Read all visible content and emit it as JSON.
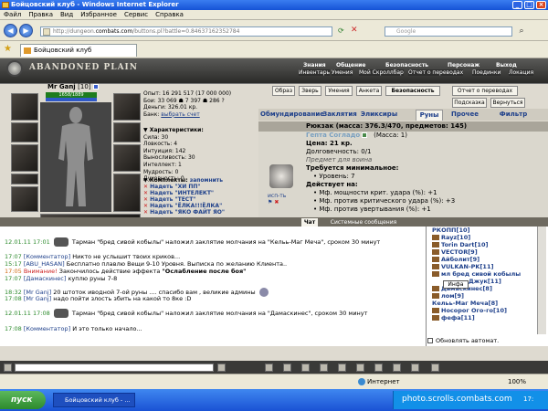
{
  "window": {
    "title": "Бойцовский клуб - Windows Internet Explorer"
  },
  "menu": [
    "Файл",
    "Правка",
    "Вид",
    "Избранное",
    "Сервис",
    "Справка"
  ],
  "address": {
    "prefix": "http://dungeon.",
    "domain": "combats.com",
    "suffix": "/buttons.pl?battle=0.84637162352784"
  },
  "search": {
    "placeholder": "Google"
  },
  "tab": {
    "label": "Бойцовский клуб"
  },
  "game": {
    "logo": "ABANDONED PLAIN",
    "topmenu": {
      "row1": [
        "Знания",
        "Общение",
        "Безопасность",
        "Персонаж",
        "Выход"
      ],
      "row2": [
        "Инвентарь",
        "Умения",
        "Мой Скроллбар",
        "Отчет о переводах",
        "Поединки",
        "Локация"
      ]
    },
    "character": {
      "name": "Mr Ganj",
      "level": "[10]",
      "hp": "1658/1889",
      "stats_top": [
        "Опыт: 16 291 517 (17 000 000)",
        "Бои: 33 069 ☗ 7 397 ☗ 286 ?",
        "Деньги: 326.01 кр.",
        "Банк:"
      ],
      "bank_link": "выбрать счет",
      "stats_header": "Характеристики:",
      "stats": [
        "Сила: 30",
        "Ловкость: 4",
        "Интуиция: 142",
        "Выносливость: 30",
        "Интеллект: 1",
        "Мудрость: 0",
        "Духовность: 0"
      ],
      "sets_header": "Комплекты:",
      "sets_remember": "запомнить",
      "sets": [
        "Надеть \"ХИ ПП\"",
        "Надеть \"ИНТЕЛЕКТ\"",
        "Надеть \"ТЕСТ\"",
        "Надеть \"ЁЛКА!!!ЁЛКА\"",
        "Надеть \"ЯКО ФАЙТ ЯО\""
      ]
    },
    "shop": {
      "buttons": [
        "Образ",
        "Зверь",
        "Умения",
        "Анкета",
        "Безопасность",
        "Отчет о переводах"
      ],
      "buttons2": [
        "Подсказка",
        "Вернуться"
      ],
      "tabs": [
        "Обмундирование",
        "Заклятия",
        "Эликсиры",
        "Руны",
        "Прочее",
        "Фильтр"
      ],
      "rucksack": "Рюкзак (масса: 376.3/470, предметов: 145)",
      "item": {
        "name": "Гепта Согладо",
        "mass": "(Масса: 1)",
        "price": "Цена: 21 кр.",
        "durability": "Долговечность: 0/1",
        "purpose": "Предмет для воина",
        "req_header": "Требуется минимальное:",
        "req": "• Уровень: 7",
        "effects_header": "Действует на:",
        "effects": [
          "• Мф. мощности крит. удара (%): +1",
          "• Мф. против критического удара (%): +3",
          "• Мф. против увертывания (%): +1"
        ],
        "use": "исп-ть"
      }
    },
    "chat": {
      "tabs": [
        "Чат",
        "Системные сообщения"
      ],
      "messages": [
        {
          "time": "12.01.11 17:01",
          "nick": "",
          "text": "Тарман \"бред сивой кобылы\" наложил заклятие молчания на \"Кельь-Маг Меча\", сроком 30 минут"
        },
        {
          "time": "17:07",
          "nick": "[Комментатор]",
          "text": "Никто не услышит твоих криков..."
        },
        {
          "time": "15:17",
          "nick": "[ABU_HASAN]",
          "text": "Бесплатно плавлю Вещи 9-10 Уровня. Выписка по желанию Клиента.."
        },
        {
          "time": "17:05",
          "nick": "",
          "text": "Закончилось действие эффекта"
        },
        {
          "time": "17:07",
          "nick": "[Дамаскинес]",
          "text": "куплю руны 7-8"
        },
        {
          "time": "18:32",
          "nick": "[Mr Ganj]",
          "text": "20 штоток иводной 7-ой руны .... спасибо вам , великие админы"
        },
        {
          "time": "17:08",
          "nick": "[Mr Ganj]",
          "text": "надо пойти злость збить на какой то 8ке :D"
        },
        {
          "time": "12.01.11 17:08",
          "nick": "",
          "text": "Тарман \"бред сивой кобылы\" наложил заклятие молчания на \"Дамаскинес\", сроком 30 минут"
        },
        {
          "time": "17:08",
          "nick": "[Комментатор]",
          "text": "И это только начало..."
        }
      ],
      "warning": "Внимание!",
      "effect_name": "\"Ослабление после боя\""
    },
    "users": [
      "Rayz[10]",
      "Torin Dart[10]",
      "VECTOR[9]",
      "Айболит[9]",
      "VULKAN-PK[11]",
      "мл бред сивой кобылы",
      "Джук[11]",
      "Дамаскинес[8]",
      "лом[9]",
      "Кельь-Маг Меча[8]",
      "Носорог Ого-го[10]",
      "фефа[11]"
    ],
    "users_top": "РКОПП[10]",
    "tooltip": "Инфа",
    "auto_update": "Обновлять автомат."
  },
  "statusbar": {
    "zone": "Интернет",
    "zoom": "100%"
  },
  "taskbar": {
    "start": "пуск",
    "item": "Бойцовский клуб - ...",
    "watermark": "photo.scrolls.combats.com",
    "clock": "17:"
  }
}
